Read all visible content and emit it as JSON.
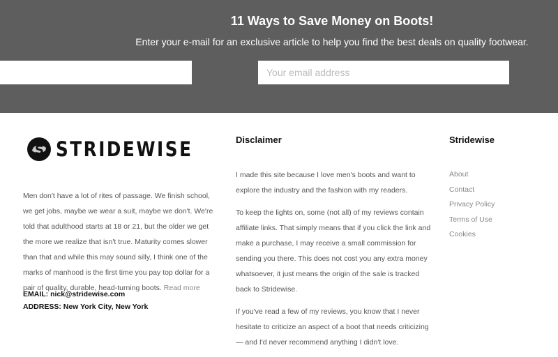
{
  "banner": {
    "title": "11 Ways to Save Money on Boots!",
    "subtitle": "Enter your e-mail for an exclusive article to help you find the best deals on quality footwear.",
    "name_value": "",
    "email_placeholder": "Your email address"
  },
  "logo": {
    "text": "STRIDEWISE"
  },
  "about": {
    "text": "Men don't have a lot of rites of passage. We finish school, we get jobs, maybe we wear a suit, maybe we don't. We're told that adulthood starts at 18 or 21, but the older we get the more we realize that isn't true. Maturity comes slower than that and while this may sound silly, I think one of the marks of manhood is the first time you pay top dollar for a pair of quality, durable, head-turning boots.",
    "read_more": "Read more",
    "email": "EMAIL: nick@stridewise.com",
    "address": "ADDRESS: New York City, New York"
  },
  "disclaimer": {
    "title": "Disclaimer",
    "paragraphs": [
      "I made this site because I love men's boots and want to explore the industry and the fashion with my readers.",
      "To keep the lights on, some (not all) of my reviews contain affiliate links. That simply means that if you click the link and make a purchase, I may receive a small commission for sending you there. This does not cost you any extra money whatsoever, it just means the origin of the sale is tracked back to Stridewise.",
      "If you've read a few of my reviews, you know that I never hesitate to criticize an aspect of a boot that needs criticizing — and I'd never recommend anything I didn't love."
    ]
  },
  "links": {
    "title": "Stridewise",
    "items": [
      "About",
      "Contact",
      "Privacy Policy",
      "Terms of Use",
      "Cookies"
    ]
  }
}
